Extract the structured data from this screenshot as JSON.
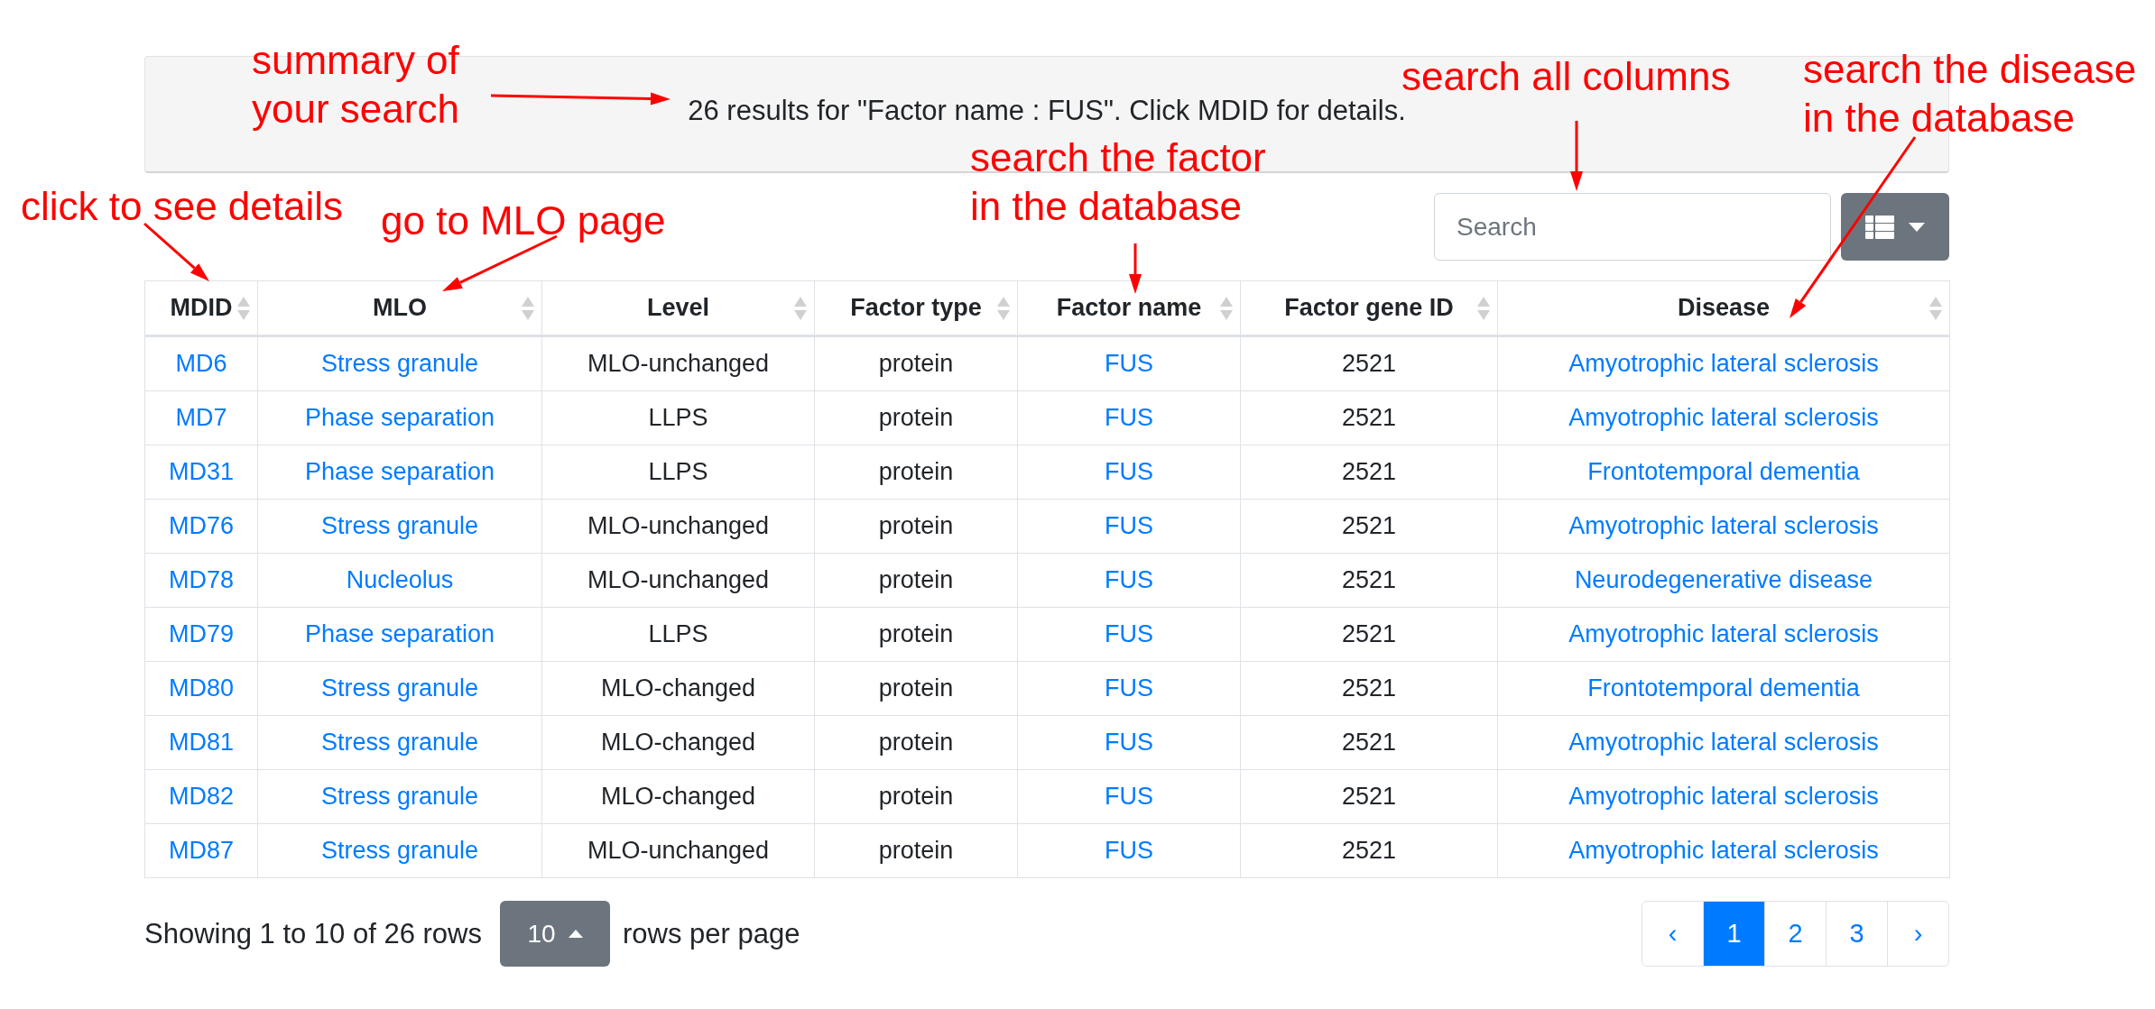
{
  "summary": {
    "text": "26 results for \"Factor name : FUS\". Click MDID for details."
  },
  "search": {
    "placeholder": "Search"
  },
  "table": {
    "columns": [
      {
        "label": "MDID",
        "link": true
      },
      {
        "label": "MLO",
        "link": true
      },
      {
        "label": "Level",
        "link": false
      },
      {
        "label": "Factor type",
        "link": false
      },
      {
        "label": "Factor name",
        "link": true
      },
      {
        "label": "Factor gene ID",
        "link": false
      },
      {
        "label": "Disease",
        "link": true
      }
    ],
    "rows": [
      [
        "MD6",
        "Stress granule",
        "MLO-unchanged",
        "protein",
        "FUS",
        "2521",
        "Amyotrophic lateral sclerosis"
      ],
      [
        "MD7",
        "Phase separation",
        "LLPS",
        "protein",
        "FUS",
        "2521",
        "Amyotrophic lateral sclerosis"
      ],
      [
        "MD31",
        "Phase separation",
        "LLPS",
        "protein",
        "FUS",
        "2521",
        "Frontotemporal dementia"
      ],
      [
        "MD76",
        "Stress granule",
        "MLO-unchanged",
        "protein",
        "FUS",
        "2521",
        "Amyotrophic lateral sclerosis"
      ],
      [
        "MD78",
        "Nucleolus",
        "MLO-unchanged",
        "protein",
        "FUS",
        "2521",
        "Neurodegenerative disease"
      ],
      [
        "MD79",
        "Phase separation",
        "LLPS",
        "protein",
        "FUS",
        "2521",
        "Amyotrophic lateral sclerosis"
      ],
      [
        "MD80",
        "Stress granule",
        "MLO-changed",
        "protein",
        "FUS",
        "2521",
        "Frontotemporal dementia"
      ],
      [
        "MD81",
        "Stress granule",
        "MLO-changed",
        "protein",
        "FUS",
        "2521",
        "Amyotrophic lateral sclerosis"
      ],
      [
        "MD82",
        "Stress granule",
        "MLO-changed",
        "protein",
        "FUS",
        "2521",
        "Amyotrophic lateral sclerosis"
      ],
      [
        "MD87",
        "Stress granule",
        "MLO-unchanged",
        "protein",
        "FUS",
        "2521",
        "Amyotrophic lateral sclerosis"
      ]
    ]
  },
  "footer": {
    "showing": "Showing 1 to 10 of 26 rows",
    "page_size": "10",
    "rows_per_page": "rows per page",
    "pagination": {
      "prev": "‹",
      "next": "›",
      "pages": [
        {
          "label": "1",
          "selected": true
        },
        {
          "label": "2",
          "selected": false
        },
        {
          "label": "3",
          "selected": false
        }
      ]
    }
  },
  "annotations": [
    {
      "text": "summary of\nyour search"
    },
    {
      "text": "click to see details"
    },
    {
      "text": "go to MLO page"
    },
    {
      "text": "search the factor\nin the database"
    },
    {
      "text": "search all columns"
    },
    {
      "text": "search the disease\nin the database"
    }
  ]
}
